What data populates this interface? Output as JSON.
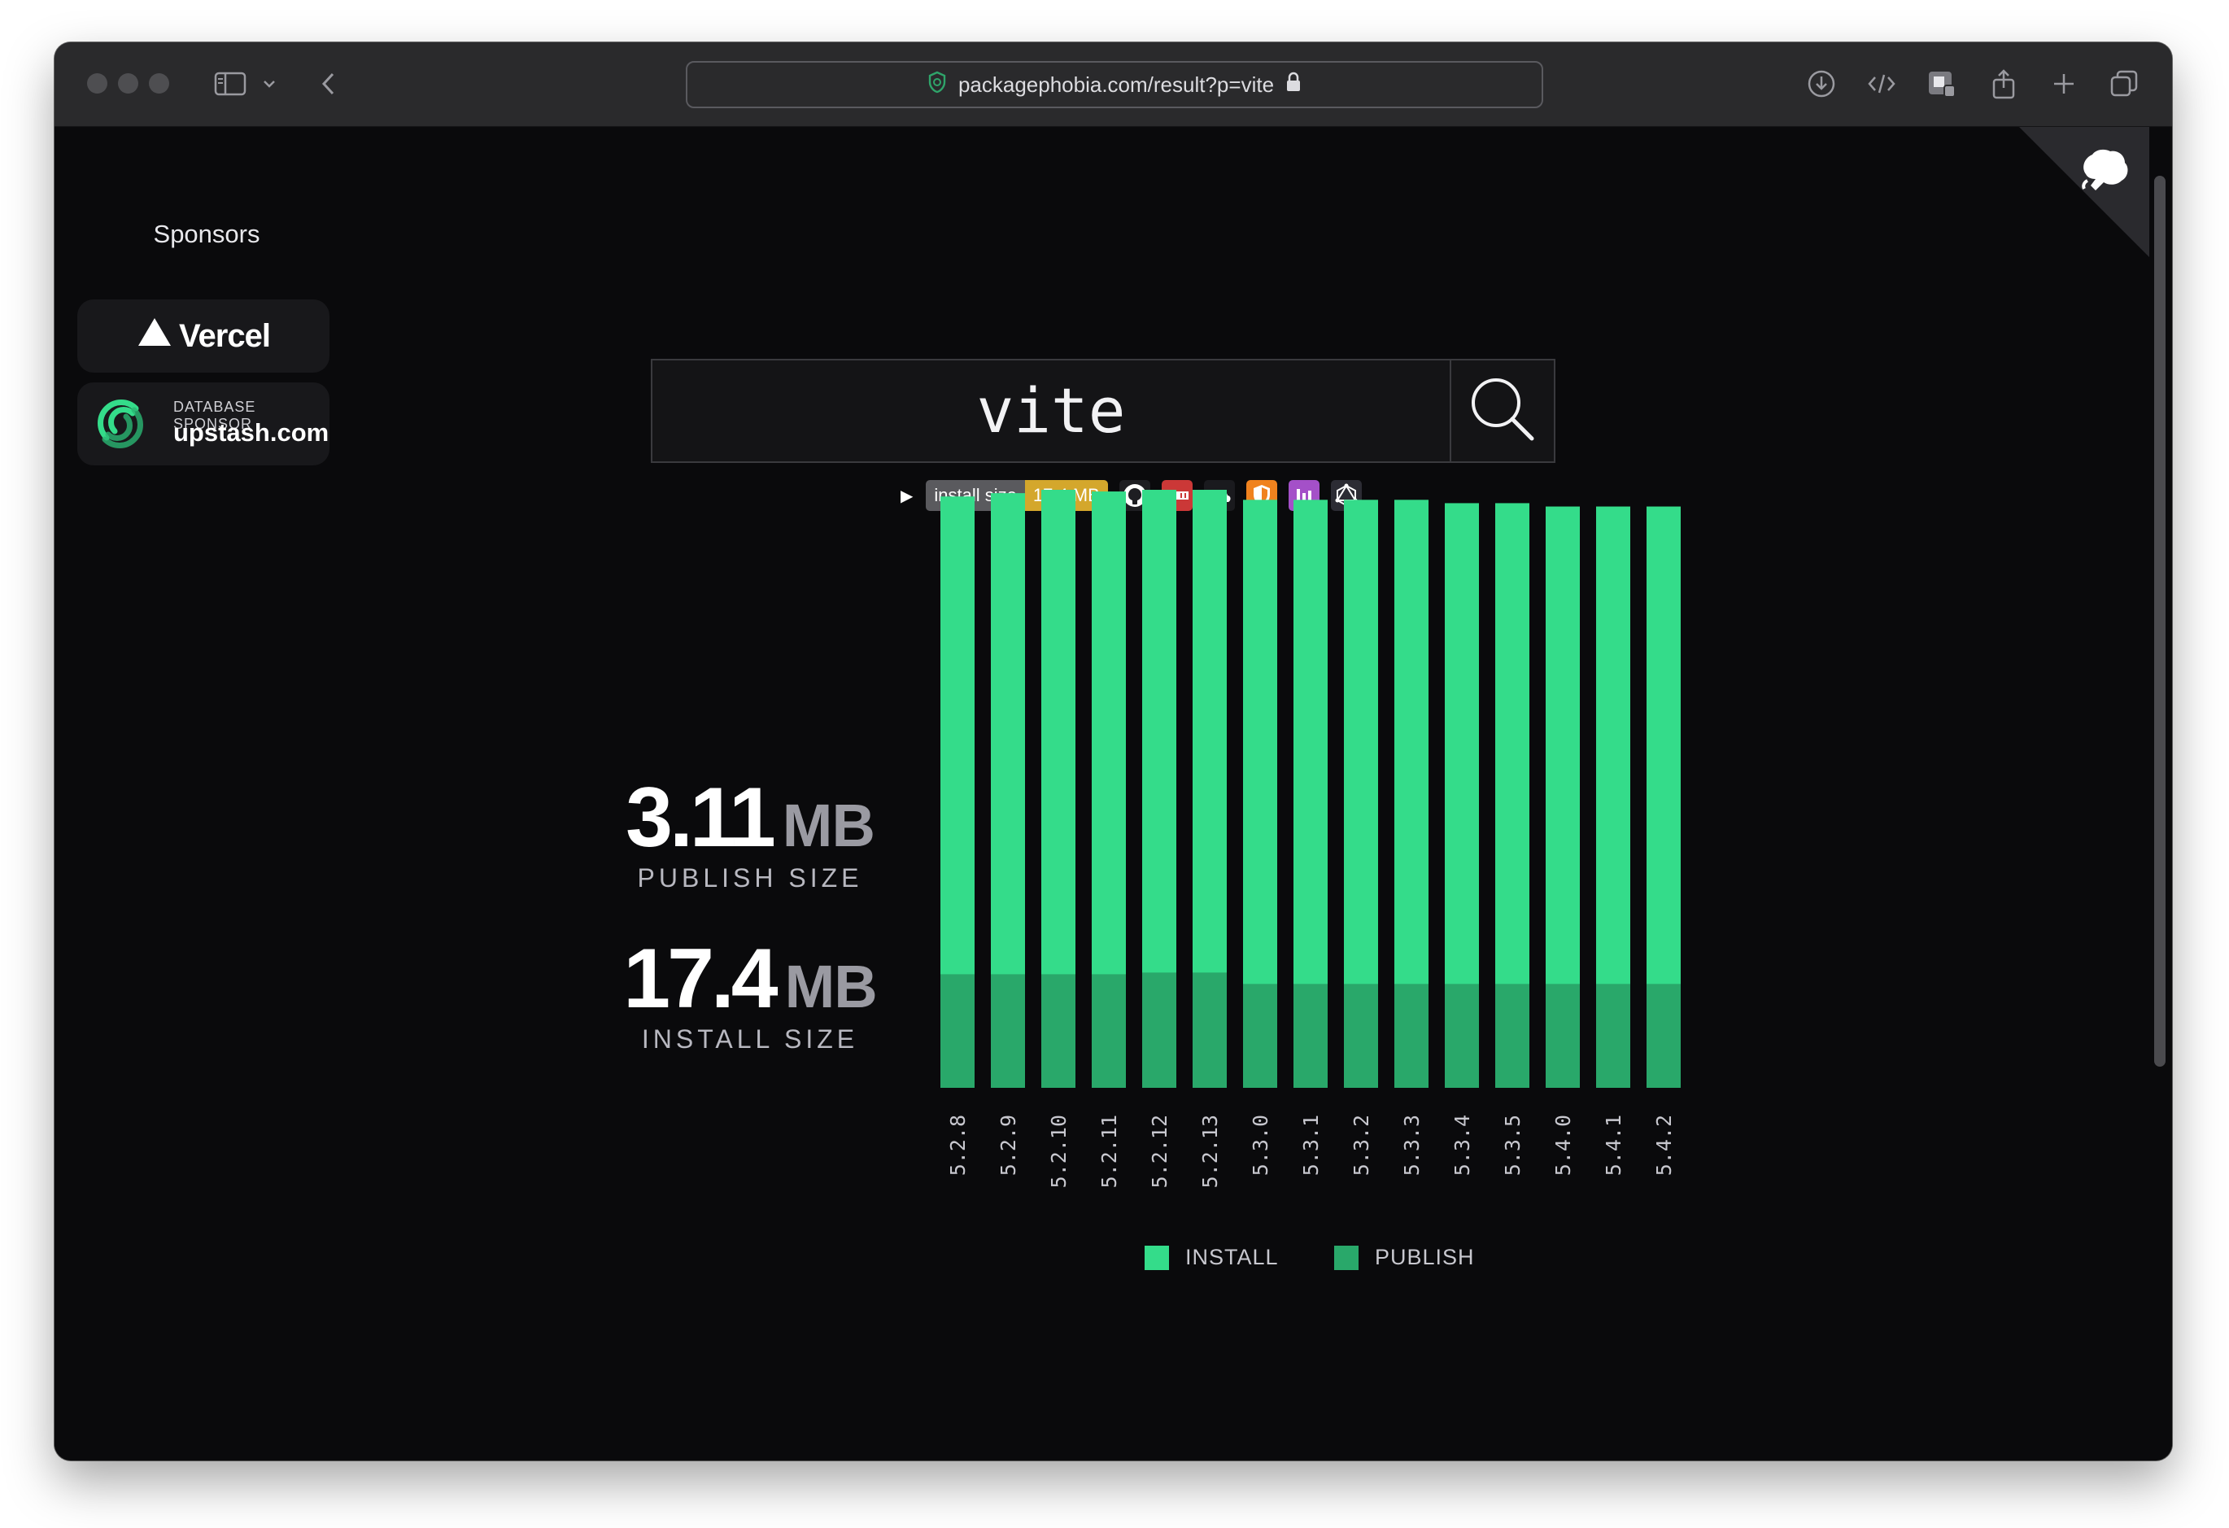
{
  "browser": {
    "url": "packagephobia.com/result?p=vite"
  },
  "sponsors": {
    "title": "Sponsors",
    "vercel_label": "Vercel",
    "upstash_caption": "DATABASE SPONSOR",
    "upstash_label": "upstash.com"
  },
  "search": {
    "query": "vite"
  },
  "badge": {
    "label": "install size",
    "value": "17.4 MB"
  },
  "stats": {
    "publish": {
      "value": "3.11",
      "unit": "MB",
      "label": "PUBLISH SIZE"
    },
    "install": {
      "value": "17.4",
      "unit": "MB",
      "label": "INSTALL SIZE"
    }
  },
  "colors": {
    "install": "#34dc8a",
    "publish": "#29a86a",
    "badge_value": "#d4a72c"
  },
  "icons": [
    "github-icon",
    "npm-icon",
    "cloud-icon",
    "shield-icon",
    "stats-icon",
    "graphql-icon",
    "search-icon",
    "octocat-icon"
  ],
  "chart_data": {
    "type": "bar",
    "stacked": true,
    "categories": [
      "5.2.8",
      "5.2.9",
      "5.2.10",
      "5.2.11",
      "5.2.12",
      "5.2.13",
      "5.3.0",
      "5.3.1",
      "5.3.2",
      "5.3.3",
      "5.3.4",
      "5.3.5",
      "5.4.0",
      "5.4.1",
      "5.4.2"
    ],
    "series": [
      {
        "name": "INSTALL",
        "values": [
          17.7,
          17.8,
          17.9,
          17.85,
          17.9,
          17.9,
          17.6,
          17.6,
          17.6,
          17.6,
          17.5,
          17.5,
          17.4,
          17.4,
          17.4
        ]
      },
      {
        "name": "PUBLISH",
        "values": [
          3.4,
          3.4,
          3.4,
          3.4,
          3.45,
          3.45,
          3.11,
          3.11,
          3.11,
          3.11,
          3.11,
          3.11,
          3.11,
          3.11,
          3.11
        ]
      }
    ],
    "legend": [
      "INSTALL",
      "PUBLISH"
    ],
    "grid": false
  }
}
